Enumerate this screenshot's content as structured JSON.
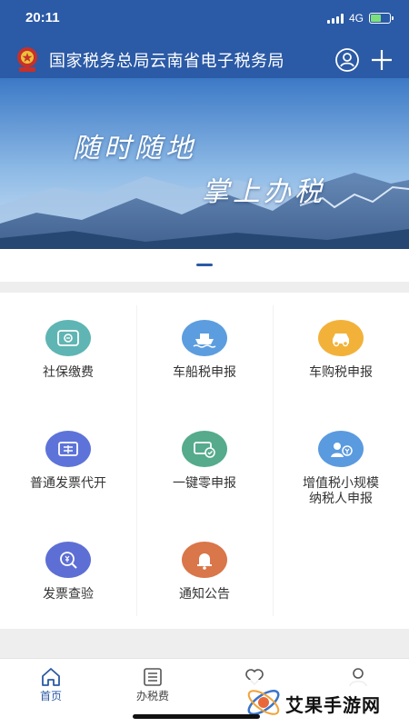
{
  "status": {
    "time": "20:11",
    "network": "4G"
  },
  "header": {
    "title": "国家税务总局云南省电子税务局",
    "user_icon": "user-icon",
    "add_icon": "plus-icon"
  },
  "banner": {
    "line1": "随时随地",
    "line2": "掌上办税"
  },
  "carousel": {
    "page_count": 1,
    "active_index": 0
  },
  "services": [
    {
      "label": "社保缴费",
      "icon": "social-security-icon",
      "color": "#5fb5b3"
    },
    {
      "label": "车船税申报",
      "icon": "ship-icon",
      "color": "#5c9ddf"
    },
    {
      "label": "车购税申报",
      "icon": "car-icon",
      "color": "#f2b23a"
    },
    {
      "label": "普通发票代开",
      "icon": "invoice-icon",
      "color": "#5d73d9"
    },
    {
      "label": "一键零申报",
      "icon": "zero-declare-icon",
      "color": "#55ab8c"
    },
    {
      "label": "增值税小规模纳税人申报",
      "icon": "taxpayer-icon",
      "color": "#5a9adf"
    },
    {
      "label": "发票查验",
      "icon": "invoice-check-icon",
      "color": "#5d6fd4"
    },
    {
      "label": "通知公告",
      "icon": "bell-icon",
      "color": "#d9764a"
    }
  ],
  "tabs": [
    {
      "label": "首页",
      "icon": "home-icon",
      "active": true
    },
    {
      "label": "办税费",
      "icon": "list-icon",
      "active": false
    },
    {
      "label": "",
      "icon": "heart-icon",
      "active": false
    },
    {
      "label": "",
      "icon": "profile-icon",
      "active": false
    }
  ],
  "watermark": {
    "text": "艾果手游网"
  },
  "colors": {
    "primary": "#2b5aa6",
    "background": "#eeeeee"
  }
}
